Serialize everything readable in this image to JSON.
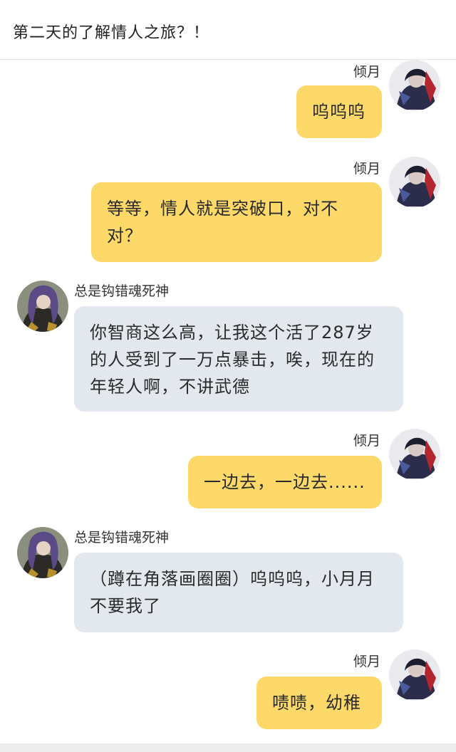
{
  "header": {
    "title": "第二天的了解情人之旅？！"
  },
  "contacts": {
    "self_name": "倾月",
    "other_name": "总是钩错魂死神"
  },
  "colors": {
    "self_bubble": "#fdd96a",
    "other_bubble": "#e3e8ee",
    "background": "#ffffff"
  },
  "messages": [
    {
      "sender": "倾月",
      "side": "right",
      "text": "呜呜呜"
    },
    {
      "sender": "倾月",
      "side": "right",
      "text": "等等，情人就是突破口，对不对？"
    },
    {
      "sender": "总是钩错魂死神",
      "side": "left",
      "text": "你智商这么高，让我这个活了287岁的人受到了一万点暴击，唉，现在的年轻人啊，不讲武德"
    },
    {
      "sender": "倾月",
      "side": "right",
      "text": "一边去，一边去......"
    },
    {
      "sender": "总是钩错魂死神",
      "side": "left",
      "text": "（蹲在角落画圈圈）呜呜呜，小月月不要我了"
    },
    {
      "sender": "倾月",
      "side": "right",
      "text": "啧啧，幼稚"
    }
  ]
}
